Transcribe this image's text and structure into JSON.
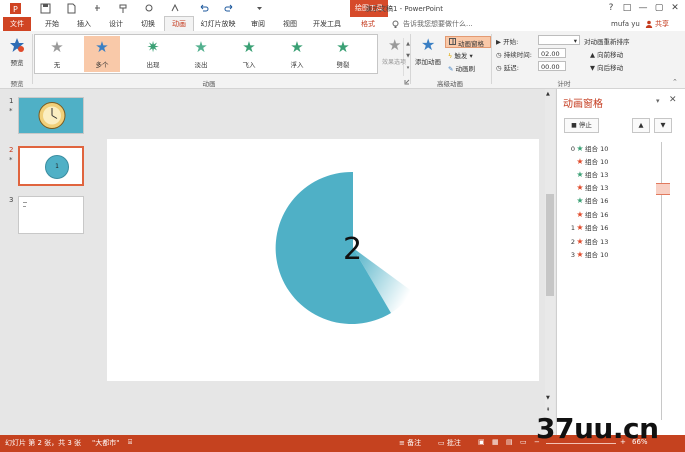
{
  "titlebar": {
    "title": "演示文稿1 - PowerPoint",
    "context_tab": "绘图工具",
    "window_controls": [
      "?",
      "□",
      "—",
      "▢",
      "✕"
    ]
  },
  "tabs": {
    "file": "文件",
    "items": [
      "开始",
      "插入",
      "设计",
      "切换",
      "动画",
      "幻灯片放映",
      "审阅",
      "视图",
      "开发工具",
      "格式"
    ],
    "active": "动画",
    "search_placeholder": "告诉我您想要做什么...",
    "user": "mufa yu",
    "share": "共享"
  },
  "ribbon": {
    "preview": {
      "label": "预览",
      "group": "预览"
    },
    "animations": [
      {
        "label": "无",
        "color": "#9a9a9a"
      },
      {
        "label": "多个",
        "color": "#3a7fc4"
      },
      {
        "label": "出现",
        "color": "#3aa074"
      },
      {
        "label": "淡出",
        "color": "#52b08e"
      },
      {
        "label": "飞入",
        "color": "#3aa074"
      },
      {
        "label": "浮入",
        "color": "#3aa074"
      },
      {
        "label": "劈裂",
        "color": "#3aa074"
      }
    ],
    "animation_group": "动画",
    "effect_options": "效果选项",
    "add_animation": "添加动画",
    "animation_pane": "动画窗格",
    "trigger": "触发",
    "painter": "动画刷",
    "advanced_group": "高级动画",
    "start_label": "开始:",
    "start_value": "",
    "duration_label": "持续时间:",
    "duration_value": "02.00",
    "delay_label": "延迟:",
    "delay_value": "00.00",
    "reorder_title": "对动画重新排序",
    "move_earlier": "向前移动",
    "move_later": "向后移动",
    "timing_group": "计时"
  },
  "thumbnails": [
    {
      "number": "1",
      "marker": "*"
    },
    {
      "number": "2",
      "marker": "*",
      "label": "1"
    },
    {
      "number": "3"
    }
  ],
  "slide": {
    "number_label": "2",
    "shape_color": "#4fb0c6"
  },
  "animation_pane": {
    "title": "动画窗格",
    "stop_button": "停止",
    "items": [
      {
        "index": "0",
        "star_color": "#3aa074",
        "name": "组合 10"
      },
      {
        "index": "",
        "star_color": "#e04a2a",
        "name": "组合 10"
      },
      {
        "index": "",
        "star_color": "#3aa074",
        "name": "组合 13"
      },
      {
        "index": "",
        "star_color": "#e04a2a",
        "name": "组合 13"
      },
      {
        "index": "",
        "star_color": "#3aa074",
        "name": "组合 16"
      },
      {
        "index": "",
        "star_color": "#e04a2a",
        "name": "组合 16"
      },
      {
        "index": "1",
        "star_color": "#e04a2a",
        "name": "组合 16"
      },
      {
        "index": "2",
        "star_color": "#e04a2a",
        "name": "组合 13"
      },
      {
        "index": "3",
        "star_color": "#e04a2a",
        "name": "组合 10"
      }
    ]
  },
  "statusbar": {
    "slide_info": "幻灯片 第 2 张，共 3 张",
    "theme": "\"大都市\"",
    "notes": "备注",
    "comments": "批注",
    "zoom": "66%"
  },
  "watermark": "37uu.cn"
}
